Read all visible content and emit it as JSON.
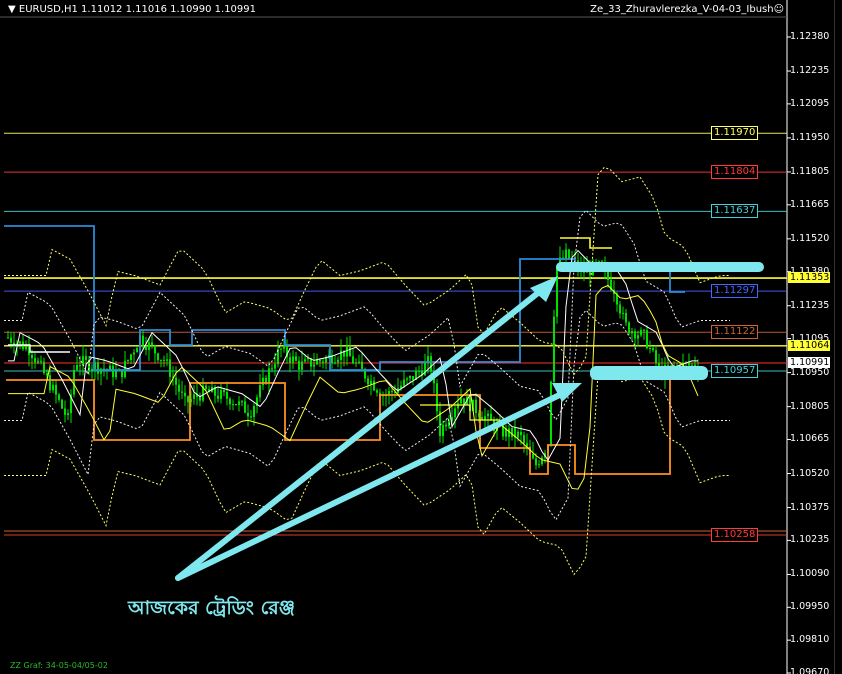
{
  "header": {
    "symbol_info": "▼ EURUSD,H1  1.11012 1.11016 1.10990 1.10991",
    "indicator_name": "Ze_33_Zhuravlerezka_V-04-03_Ibush☺"
  },
  "footer": {
    "label": "ZZ Graf: 34-05-04/05-02"
  },
  "annotation": {
    "text": "আজকের ট্রেডিং রেঞ্জ",
    "color": "#7fe8ee"
  },
  "colors": {
    "background": "#000000",
    "candle": "#00e000",
    "axis": "#ffffff",
    "arrow": "#7fe8ee",
    "yellow_line": "#ffff33"
  },
  "price_axis": {
    "labels": [
      "1.12380",
      "1.12235",
      "1.12095",
      "1.11950",
      "1.11805",
      "1.11665",
      "1.11520",
      "1.11380",
      "1.11235",
      "1.11095",
      "1.10950",
      "1.10805",
      "1.10665",
      "1.10520",
      "1.10375",
      "1.10235",
      "1.10090",
      "1.09950",
      "1.09810",
      "1.09670"
    ]
  },
  "levels": [
    {
      "value": "1.11970",
      "color": "#ffff66"
    },
    {
      "value": "1.11804",
      "color": "#ff3b3b"
    },
    {
      "value": "1.11637",
      "color": "#44d0d8"
    },
    {
      "value": "1.11297",
      "color": "#4466ff"
    },
    {
      "value": "1.11122",
      "color": "#c86432"
    },
    {
      "value": "1.10957",
      "color": "#44d0d8"
    },
    {
      "value": "1.10258",
      "color": "#ff3b3b"
    }
  ],
  "price_tags": [
    {
      "value": "1.11353",
      "bg": "#ffff33",
      "fg": "#000000"
    },
    {
      "value": "1.11064",
      "bg": "#ffff33",
      "fg": "#000000"
    },
    {
      "value": "1.10991",
      "bg": "#ffffff",
      "fg": "#000000"
    }
  ]
}
